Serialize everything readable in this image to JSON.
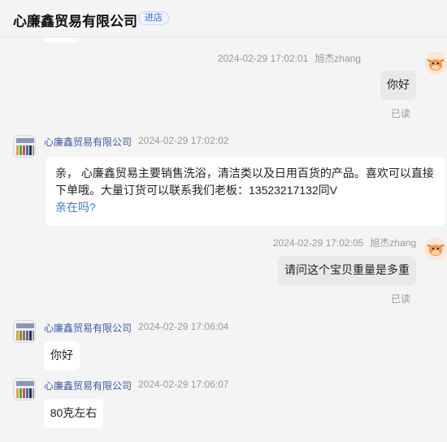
{
  "header": {
    "shop_name": "心廉鑫贸易有限公司",
    "enter_label": "进店"
  },
  "messages": [
    {
      "side": "me",
      "time": "2024-02-29 17:02:01",
      "sender": "旭杰zhang",
      "text": "你好",
      "status": "已读"
    },
    {
      "side": "them",
      "sender": "心廉鑫贸易有限公司",
      "time": "2024-02-29 17:02:02",
      "text": "亲， 心廉鑫贸易主要销售洗浴，清洁类以及日用百货的产品。喜欢可以直接下单哦。大量订货可以联系我们老板：13523217132同V",
      "link": "亲在吗?"
    },
    {
      "side": "me",
      "time": "2024-02-29 17:02:05",
      "sender": "旭杰zhang",
      "text": "请问这个宝贝重量是多重",
      "status": "已读"
    },
    {
      "side": "them",
      "sender": "心廉鑫贸易有限公司",
      "time": "2024-02-29 17:06:04",
      "text": "你好"
    },
    {
      "side": "them",
      "sender": "心廉鑫贸易有限公司",
      "time": "2024-02-29 17:06:07",
      "text": "80克左右"
    }
  ],
  "colors": {
    "accent_link": "#3a7bd5",
    "shop_name_blue": "#3b5aa8",
    "me_bubble": "#e9e9e9",
    "them_bubble": "#ffffff"
  }
}
